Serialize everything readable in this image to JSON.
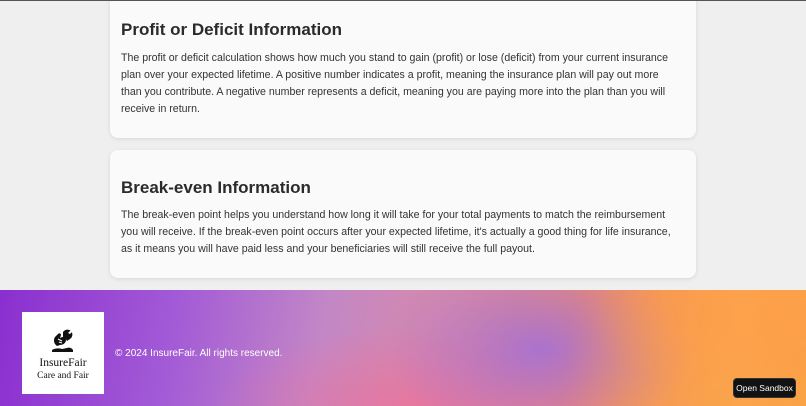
{
  "sections": [
    {
      "title": "Profit or Deficit Information",
      "body": "The profit or deficit calculation shows how much you stand to gain (profit) or lose (deficit) from your current insurance plan over your expected lifetime. A positive number indicates a profit, meaning the insurance plan will pay out more than you contribute. A negative number represents a deficit, meaning you are paying more into the plan than you will receive in return."
    },
    {
      "title": "Break-even Information",
      "body": "The break-even point helps you understand how long it will take for your total payments to match the reimbursement you will receive. If the break-even point occurs after your expected lifetime, it's actually a good thing for life insurance, as it means you will have paid less and your beneficiaries will still receive the full payout."
    }
  ],
  "footer": {
    "logo": {
      "icon": "hands-logo-icon",
      "name": "InsureFair",
      "tagline": "Care and Fair"
    },
    "copyright": "© 2024 InsureFair. All rights reserved."
  },
  "sandbox_button": {
    "label": "Open Sandbox"
  },
  "colors": {
    "page_background": "#efefef",
    "card_background": "#fafafa",
    "footer_gradient_start": "#8a2fd0",
    "footer_gradient_end": "#f5a040",
    "button_background": "#121212"
  }
}
